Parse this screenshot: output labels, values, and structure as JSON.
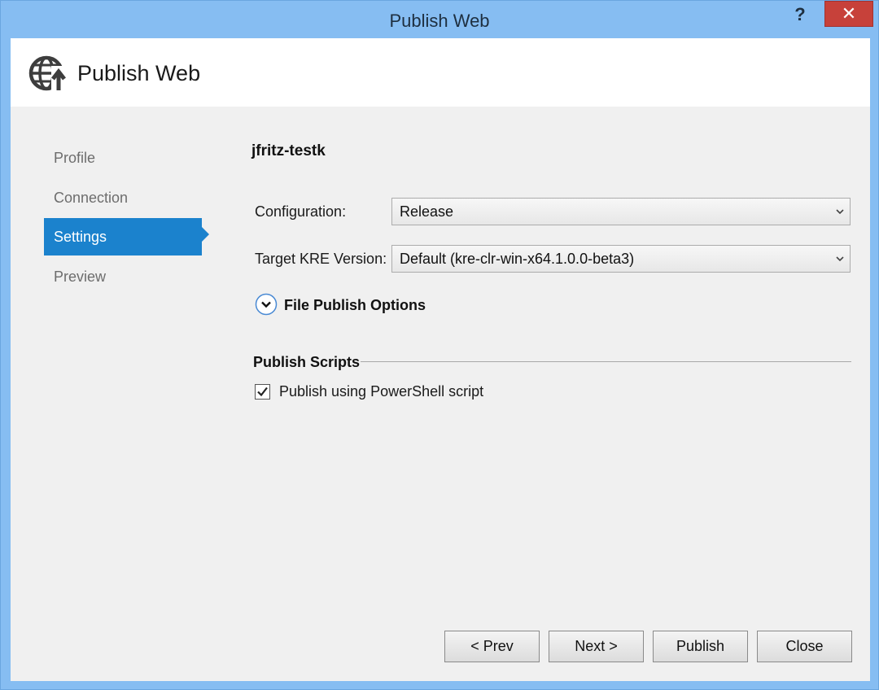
{
  "window": {
    "title": "Publish Web",
    "help_label": "?",
    "close_label": "✕"
  },
  "banner": {
    "title": "Publish Web",
    "icon": "globe-upload-icon"
  },
  "nav": {
    "items": [
      {
        "label": "Profile"
      },
      {
        "label": "Connection"
      },
      {
        "label": "Settings"
      },
      {
        "label": "Preview"
      }
    ],
    "active": "Settings"
  },
  "settings": {
    "profile_name": "jfritz-testk",
    "configuration": {
      "label": "Configuration:",
      "value": "Release"
    },
    "target_kre": {
      "label": "Target KRE Version:",
      "value": "Default (kre-clr-win-x64.1.0.0-beta3)"
    },
    "file_publish_options": {
      "label": "File Publish Options",
      "expanded": false
    },
    "publish_scripts": {
      "title": "Publish Scripts",
      "powershell": {
        "label": "Publish using PowerShell script",
        "checked": true
      }
    }
  },
  "buttons": {
    "prev": "< Prev",
    "next": "Next >",
    "publish": "Publish",
    "close": "Close"
  },
  "colors": {
    "titlebar": "#86bdf2",
    "accent": "#1b82cd",
    "close": "#c7413a"
  }
}
